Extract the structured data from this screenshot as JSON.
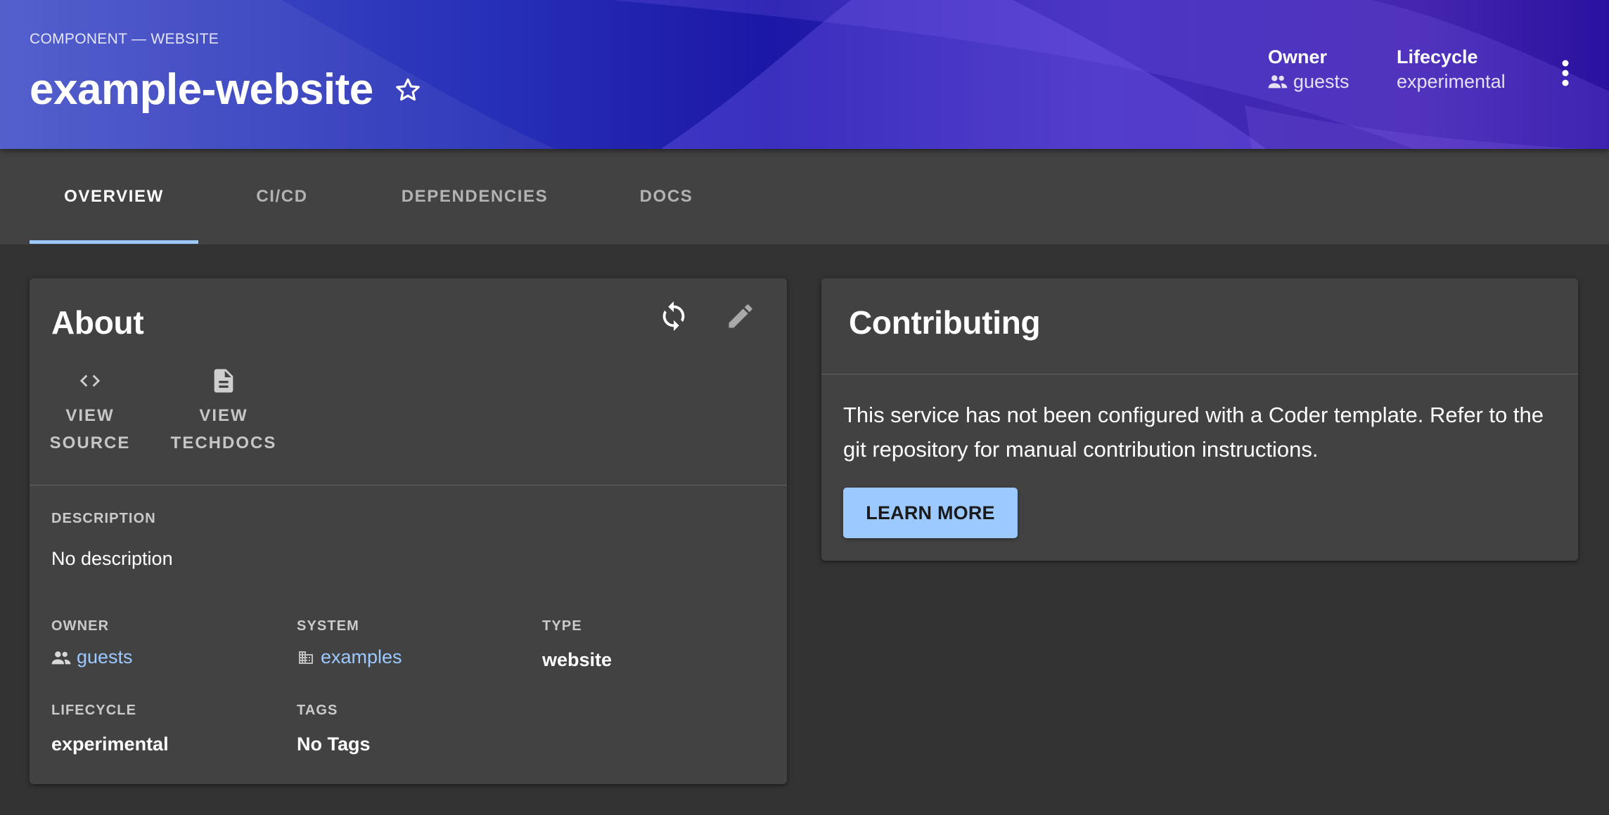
{
  "header": {
    "kicker": "COMPONENT — WEBSITE",
    "title": "example-website",
    "owner_label": "Owner",
    "owner_value": "guests",
    "lifecycle_label": "Lifecycle",
    "lifecycle_value": "experimental"
  },
  "tabs": [
    {
      "label": "OVERVIEW",
      "active": true
    },
    {
      "label": "CI/CD",
      "active": false
    },
    {
      "label": "DEPENDENCIES",
      "active": false
    },
    {
      "label": "DOCS",
      "active": false
    }
  ],
  "about": {
    "title": "About",
    "actions": [
      {
        "line1": "VIEW",
        "line2": "SOURCE",
        "icon": "code-icon"
      },
      {
        "line1": "VIEW",
        "line2": "TECHDOCS",
        "icon": "document-icon"
      }
    ],
    "description_label": "DESCRIPTION",
    "description_value": "No description",
    "owner_label": "OWNER",
    "owner_value": "guests",
    "system_label": "SYSTEM",
    "system_value": "examples",
    "type_label": "TYPE",
    "type_value": "website",
    "lifecycle_label": "LIFECYCLE",
    "lifecycle_value": "experimental",
    "tags_label": "TAGS",
    "tags_value": "No Tags"
  },
  "contributing": {
    "title": "Contributing",
    "text": "This service has not been configured with a Coder template. Refer to the git repository for manual contribution instructions.",
    "button_label": "LEARN MORE"
  },
  "colors": {
    "accent": "#9cc9ff",
    "background": "#333333",
    "card": "#424242"
  }
}
